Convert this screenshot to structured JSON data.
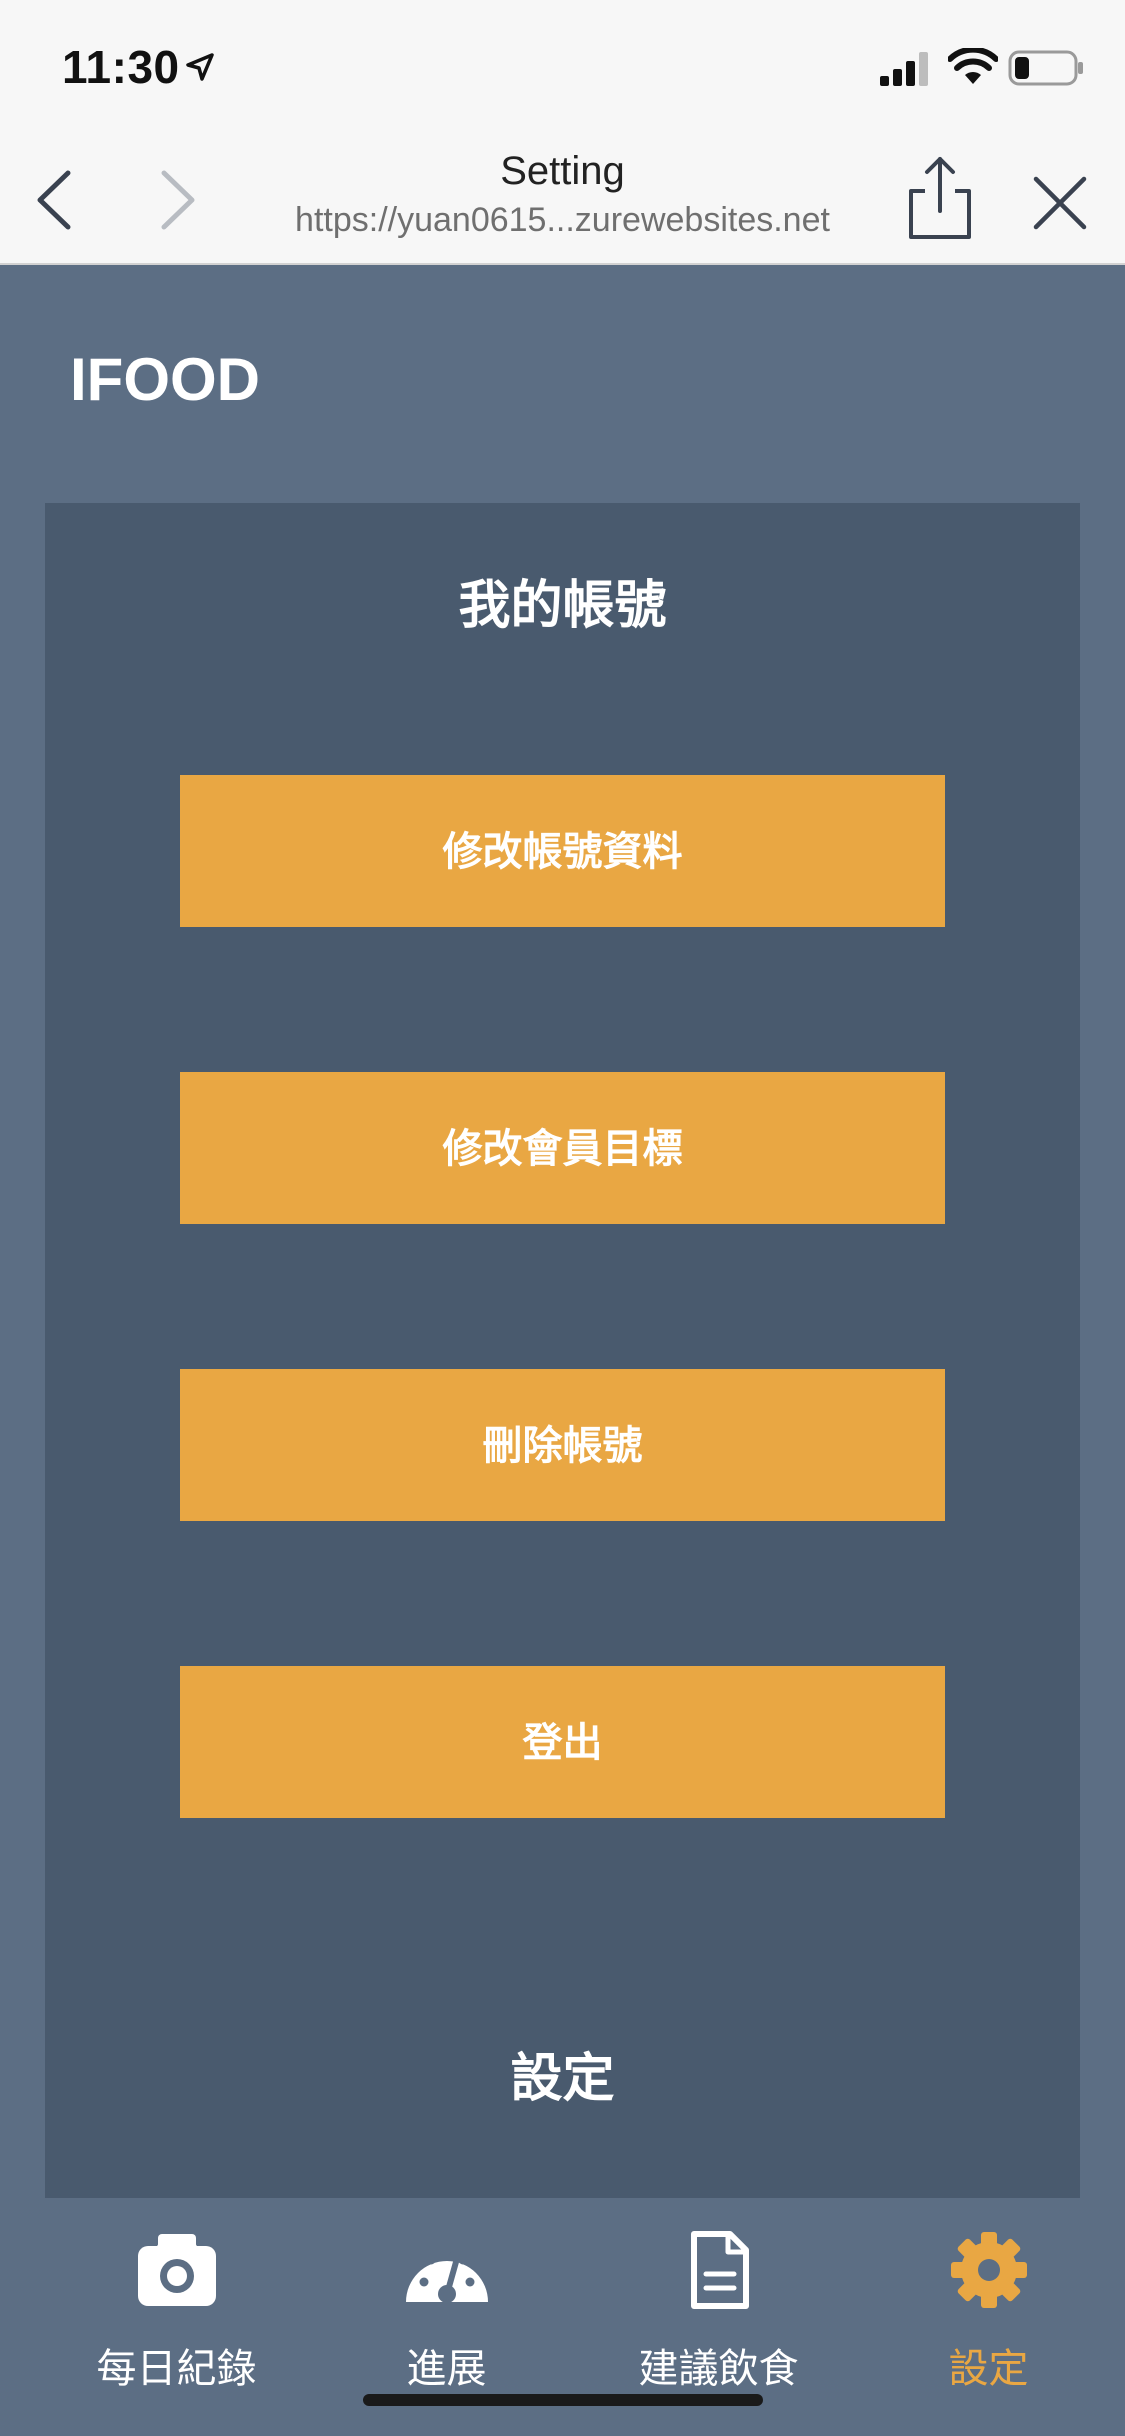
{
  "status": {
    "time": "11:30"
  },
  "browser": {
    "title": "Setting",
    "url": "https://yuan0615...zurewebsites.net"
  },
  "app": {
    "brand": "IFOOD"
  },
  "account": {
    "title": "我的帳號",
    "buttons": [
      "修改帳號資料",
      "修改會員目標",
      "刪除帳號",
      "登出"
    ]
  },
  "settings": {
    "title": "設定"
  },
  "tabs": [
    {
      "label": "每日紀錄",
      "icon": "camera-icon"
    },
    {
      "label": "進展",
      "icon": "speedometer-icon"
    },
    {
      "label": "建議飲食",
      "icon": "document-icon"
    },
    {
      "label": "設定",
      "icon": "gear-icon",
      "active": true
    }
  ],
  "colors": {
    "accent": "#e9a743",
    "header": "#5c6e84",
    "panel": "#495a6e"
  }
}
